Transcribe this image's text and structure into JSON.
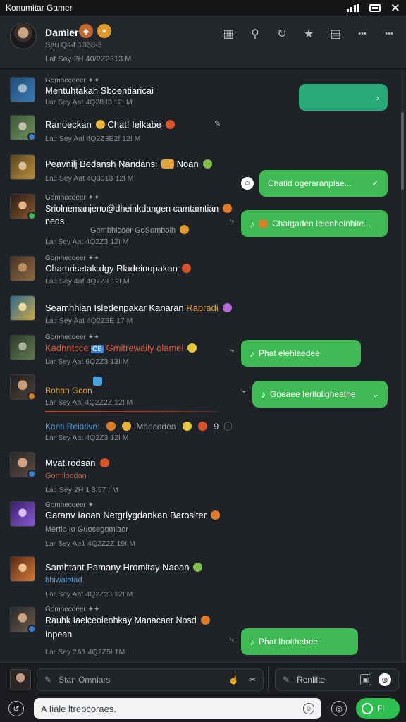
{
  "app": {
    "title": "Konumitar Gamer"
  },
  "header": {
    "name": "Damier",
    "subtitle": "Sau Q44 1338-3",
    "timestamp": "Lat Sey 2H 40/2Z2313 M",
    "actions": [
      {
        "name": "grid-icon",
        "glyph": "▦"
      },
      {
        "name": "search-icon",
        "glyph": "⚲"
      },
      {
        "name": "refresh-icon",
        "glyph": "↻"
      },
      {
        "name": "star-icon",
        "glyph": "★"
      },
      {
        "name": "notes-icon",
        "glyph": "▤"
      },
      {
        "name": "more-icon",
        "glyph": "•••"
      },
      {
        "name": "overflow-icon",
        "glyph": "•••"
      }
    ]
  },
  "messages": [
    {
      "author": "Gomhecoeer ✦✦",
      "text": "Mentuhtakah Sboentiaricai",
      "time": "Lar Sey Aat 4Q28 I3 12I M"
    },
    {
      "text": "Ranoeckan",
      "text2": "Chat! Ielkabe",
      "time": "Lac Sey Aal 4Q2Z3E2f 12I M"
    },
    {
      "text": "Peavnilj Bedansh Nandansi",
      "text2": "Noan",
      "time": "Lac Sey Aat 4Q3013 12I M"
    },
    {
      "author": "Gomhecoeer ✦✦",
      "text": "Sriolnemanjeno@dheinkdangen camtamtian",
      "text2": "neds",
      "sub": "Gombhicoer GoSomboih",
      "time": "Lar Sey Aat 4Q2Z3 12I M"
    },
    {
      "author": "Gomhecoeer ✦✦",
      "text": "Chamrisetak:dgy Rladeinopakan",
      "time": "Lac Sey 4af 4Q7Z3 12I M"
    },
    {
      "text": "Seamhhian Isledenpakar Kanaran",
      "text2": "Rapradi",
      "time": "Lac Sey Aat 4Q2Z3E 17 M"
    },
    {
      "author": "Gomhecoeer ✦✦",
      "text": "Kadnntcce",
      "text2": "Gmitrewaily olamel",
      "time": "Lar Sey Aat 6Q2Z3 13I M"
    },
    {
      "text": "Bohan Gcon",
      "time": "Lar Sey Aal 4Q2Z2Z 12I M"
    },
    {
      "text": "Mvat rodsan",
      "sub": "Gomilocdan",
      "time": "Lac Sey 2H 1 3 57 I M"
    },
    {
      "author": "Gomhecoeer ✦",
      "text": "Garanv Iaoan Netgrlygdankan Barositer",
      "sub": "Mertlo Io Guosegomiaor",
      "time": "Lar Sey Ae1 4Q2Z2Z 19I M"
    },
    {
      "text": "Samhtant Pamany Hromitay Naoan",
      "sub": "bhiwalotad",
      "time": "Lar Sey Aat 4Q2Z23 12I M"
    },
    {
      "author": "Gomhecoeer ✦✦",
      "text": "Rauhk Iaelceolenhkay Manacaer Nosd",
      "text2": "Inpean",
      "time": "Lar Sey 2A1 4Q2Z5I 1M"
    }
  ],
  "relative": {
    "label": "Kanti Relative:",
    "name": "Madcoden",
    "time": "Lar Sey Aat 4Q2Z3 12I M"
  },
  "bubbles": [
    {
      "text": "",
      "check": "›"
    },
    {
      "text": "Chatid ogeraranplae...",
      "check": "✓"
    },
    {
      "text": "Chatgaden Ieienheinhite...",
      "check": ""
    },
    {
      "text": "Phat elehlaedee",
      "check": ""
    },
    {
      "text": "Goeaee Ieritoligheathe",
      "check": "⌄"
    },
    {
      "text": "Phat Ihoithebee",
      "check": ""
    }
  ],
  "composer": {
    "placeholder1": "Stan Omniars",
    "placeholder2": "Renlilte",
    "main_placeholder": "A Iiale ltrepcoraes.",
    "send_label": "Fl"
  }
}
